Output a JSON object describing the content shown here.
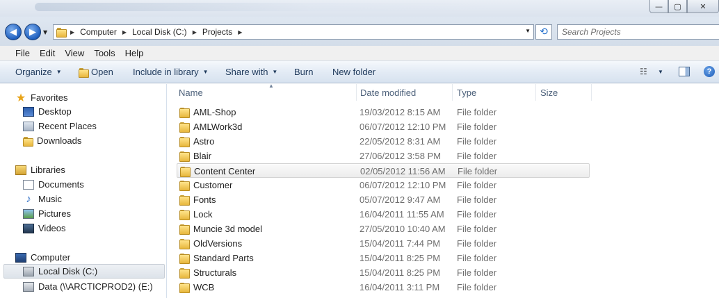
{
  "window": {
    "minimize_glyph": "—",
    "maximize_glyph": "▢",
    "close_glyph": "✕"
  },
  "address": {
    "crumbs": [
      "Computer",
      "Local Disk (C:)",
      "Projects"
    ],
    "search_placeholder": "Search Projects"
  },
  "menu": [
    "File",
    "Edit",
    "View",
    "Tools",
    "Help"
  ],
  "commands": {
    "organize": "Organize",
    "open": "Open",
    "include": "Include in library",
    "share": "Share with",
    "burn": "Burn",
    "new_folder": "New folder"
  },
  "nav": {
    "favorites": "Favorites",
    "desktop": "Desktop",
    "recent": "Recent Places",
    "downloads": "Downloads",
    "libraries": "Libraries",
    "documents": "Documents",
    "music": "Music",
    "pictures": "Pictures",
    "videos": "Videos",
    "computer": "Computer",
    "local_disk": "Local Disk (C:)",
    "data_drive": "Data (\\\\ARCTICPROD2) (E:)"
  },
  "columns": {
    "name": "Name",
    "date": "Date modified",
    "type": "Type",
    "size": "Size"
  },
  "files": [
    {
      "name": "AML-Shop",
      "date": "19/03/2012 8:15 AM",
      "type": "File folder"
    },
    {
      "name": "AMLWork3d",
      "date": "06/07/2012 12:10 PM",
      "type": "File folder"
    },
    {
      "name": "Astro",
      "date": "22/05/2012 8:31 AM",
      "type": "File folder"
    },
    {
      "name": "Blair",
      "date": "27/06/2012 3:58 PM",
      "type": "File folder"
    },
    {
      "name": "Content Center",
      "date": "02/05/2012 11:56 AM",
      "type": "File folder"
    },
    {
      "name": "Customer",
      "date": "06/07/2012 12:10 PM",
      "type": "File folder"
    },
    {
      "name": "Fonts",
      "date": "05/07/2012 9:47 AM",
      "type": "File folder"
    },
    {
      "name": "Lock",
      "date": "16/04/2011 11:55 AM",
      "type": "File folder"
    },
    {
      "name": "Muncie 3d model",
      "date": "27/05/2010 10:40 AM",
      "type": "File folder"
    },
    {
      "name": "OldVersions",
      "date": "15/04/2011 7:44 PM",
      "type": "File folder"
    },
    {
      "name": "Standard Parts",
      "date": "15/04/2011 8:25 PM",
      "type": "File folder"
    },
    {
      "name": "Structurals",
      "date": "15/04/2011 8:25 PM",
      "type": "File folder"
    },
    {
      "name": "WCB",
      "date": "16/04/2011 3:11 PM",
      "type": "File folder"
    }
  ]
}
